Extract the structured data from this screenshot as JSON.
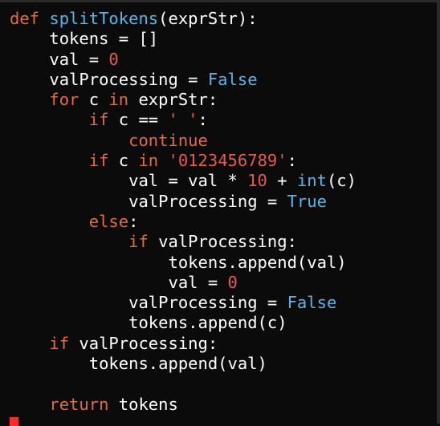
{
  "editor": {
    "lines": [
      [
        {
          "t": "kw",
          "v": "def"
        },
        {
          "t": "txt",
          "v": " "
        },
        {
          "t": "fn",
          "v": "splitTokens"
        },
        {
          "t": "txt",
          "v": "(exprStr):"
        }
      ],
      [
        {
          "t": "txt",
          "v": "    tokens = []"
        }
      ],
      [
        {
          "t": "txt",
          "v": "    val = "
        },
        {
          "t": "num",
          "v": "0"
        }
      ],
      [
        {
          "t": "txt",
          "v": "    valProcessing = "
        },
        {
          "t": "bool",
          "v": "False"
        }
      ],
      [
        {
          "t": "kw",
          "v": "    for"
        },
        {
          "t": "txt",
          "v": " c "
        },
        {
          "t": "kw",
          "v": "in"
        },
        {
          "t": "txt",
          "v": " exprStr:"
        }
      ],
      [
        {
          "t": "kw",
          "v": "        if"
        },
        {
          "t": "txt",
          "v": " c == "
        },
        {
          "t": "str",
          "v": "' '"
        },
        {
          "t": "txt",
          "v": ":"
        }
      ],
      [
        {
          "t": "kw",
          "v": "            continue"
        }
      ],
      [
        {
          "t": "kw",
          "v": "        if"
        },
        {
          "t": "txt",
          "v": " c "
        },
        {
          "t": "kw",
          "v": "in"
        },
        {
          "t": "txt",
          "v": " "
        },
        {
          "t": "str",
          "v": "'0123456789'"
        },
        {
          "t": "txt",
          "v": ":"
        }
      ],
      [
        {
          "t": "txt",
          "v": "            val = val * "
        },
        {
          "t": "num",
          "v": "10"
        },
        {
          "t": "txt",
          "v": " + "
        },
        {
          "t": "fn",
          "v": "int"
        },
        {
          "t": "txt",
          "v": "(c)"
        }
      ],
      [
        {
          "t": "txt",
          "v": "            valProcessing = "
        },
        {
          "t": "bool",
          "v": "True"
        }
      ],
      [
        {
          "t": "kw",
          "v": "        else"
        },
        {
          "t": "txt",
          "v": ":"
        }
      ],
      [
        {
          "t": "kw",
          "v": "            if"
        },
        {
          "t": "txt",
          "v": " valProcessing:"
        }
      ],
      [
        {
          "t": "txt",
          "v": "                tokens.append(val)"
        }
      ],
      [
        {
          "t": "txt",
          "v": "                val = "
        },
        {
          "t": "num",
          "v": "0"
        }
      ],
      [
        {
          "t": "txt",
          "v": "            valProcessing = "
        },
        {
          "t": "bool",
          "v": "False"
        }
      ],
      [
        {
          "t": "txt",
          "v": "            tokens.append(c)"
        }
      ],
      [
        {
          "t": "kw",
          "v": "    if"
        },
        {
          "t": "txt",
          "v": " valProcessing:"
        }
      ],
      [
        {
          "t": "txt",
          "v": "        tokens.append(val)"
        }
      ],
      [
        {
          "t": "txt",
          "v": ""
        }
      ],
      [
        {
          "t": "kw",
          "v": "    return"
        },
        {
          "t": "txt",
          "v": " tokens"
        }
      ]
    ]
  },
  "colors": {
    "background": "#0b0b0b",
    "keyword": "#e06c42",
    "function": "#56b6e8",
    "number": "#e65a4f",
    "text": "#ffffff",
    "cursor": "#ff2a2a"
  }
}
